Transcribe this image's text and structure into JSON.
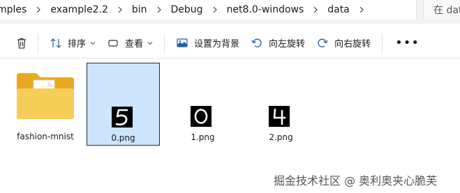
{
  "breadcrumb": [
    "mples",
    "example2.2",
    "bin",
    "Debug",
    "net8.0-windows",
    "data"
  ],
  "search": {
    "placeholder": "在 data"
  },
  "toolbar": {
    "sort_label": "排序",
    "view_label": "查看",
    "set_background_label": "设置为背景",
    "rotate_left_label": "向左旋转",
    "rotate_right_label": "向右旋转",
    "more_label": "•••"
  },
  "files": [
    {
      "name": "fashion-mnist",
      "type": "folder"
    },
    {
      "name": "0.png",
      "type": "image",
      "digit": "5",
      "selected": true
    },
    {
      "name": "1.png",
      "type": "image",
      "digit": "0"
    },
    {
      "name": "2.png",
      "type": "image",
      "digit": "4"
    }
  ],
  "watermark": "掘金技术社区 @ 奥利奥夹心脆芙",
  "colors": {
    "selection": "#cce4fc",
    "folder": "#f4c348",
    "accent": "#0067c0"
  }
}
